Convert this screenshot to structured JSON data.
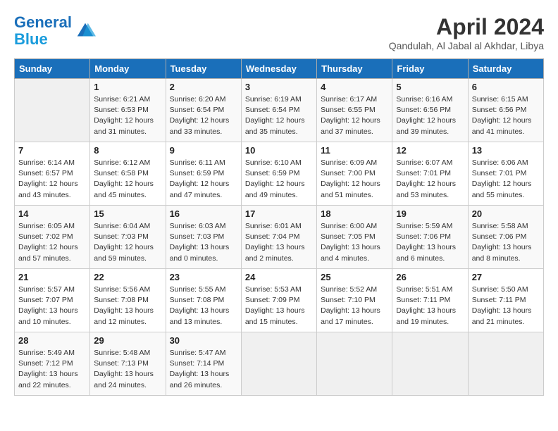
{
  "logo": {
    "line1": "General",
    "line2": "Blue"
  },
  "title": "April 2024",
  "location": "Qandulah, Al Jabal al Akhdar, Libya",
  "days_header": [
    "Sunday",
    "Monday",
    "Tuesday",
    "Wednesday",
    "Thursday",
    "Friday",
    "Saturday"
  ],
  "weeks": [
    [
      {
        "num": "",
        "info": ""
      },
      {
        "num": "1",
        "info": "Sunrise: 6:21 AM\nSunset: 6:53 PM\nDaylight: 12 hours\nand 31 minutes."
      },
      {
        "num": "2",
        "info": "Sunrise: 6:20 AM\nSunset: 6:54 PM\nDaylight: 12 hours\nand 33 minutes."
      },
      {
        "num": "3",
        "info": "Sunrise: 6:19 AM\nSunset: 6:54 PM\nDaylight: 12 hours\nand 35 minutes."
      },
      {
        "num": "4",
        "info": "Sunrise: 6:17 AM\nSunset: 6:55 PM\nDaylight: 12 hours\nand 37 minutes."
      },
      {
        "num": "5",
        "info": "Sunrise: 6:16 AM\nSunset: 6:56 PM\nDaylight: 12 hours\nand 39 minutes."
      },
      {
        "num": "6",
        "info": "Sunrise: 6:15 AM\nSunset: 6:56 PM\nDaylight: 12 hours\nand 41 minutes."
      }
    ],
    [
      {
        "num": "7",
        "info": "Sunrise: 6:14 AM\nSunset: 6:57 PM\nDaylight: 12 hours\nand 43 minutes."
      },
      {
        "num": "8",
        "info": "Sunrise: 6:12 AM\nSunset: 6:58 PM\nDaylight: 12 hours\nand 45 minutes."
      },
      {
        "num": "9",
        "info": "Sunrise: 6:11 AM\nSunset: 6:59 PM\nDaylight: 12 hours\nand 47 minutes."
      },
      {
        "num": "10",
        "info": "Sunrise: 6:10 AM\nSunset: 6:59 PM\nDaylight: 12 hours\nand 49 minutes."
      },
      {
        "num": "11",
        "info": "Sunrise: 6:09 AM\nSunset: 7:00 PM\nDaylight: 12 hours\nand 51 minutes."
      },
      {
        "num": "12",
        "info": "Sunrise: 6:07 AM\nSunset: 7:01 PM\nDaylight: 12 hours\nand 53 minutes."
      },
      {
        "num": "13",
        "info": "Sunrise: 6:06 AM\nSunset: 7:01 PM\nDaylight: 12 hours\nand 55 minutes."
      }
    ],
    [
      {
        "num": "14",
        "info": "Sunrise: 6:05 AM\nSunset: 7:02 PM\nDaylight: 12 hours\nand 57 minutes."
      },
      {
        "num": "15",
        "info": "Sunrise: 6:04 AM\nSunset: 7:03 PM\nDaylight: 12 hours\nand 59 minutes."
      },
      {
        "num": "16",
        "info": "Sunrise: 6:03 AM\nSunset: 7:03 PM\nDaylight: 13 hours\nand 0 minutes."
      },
      {
        "num": "17",
        "info": "Sunrise: 6:01 AM\nSunset: 7:04 PM\nDaylight: 13 hours\nand 2 minutes."
      },
      {
        "num": "18",
        "info": "Sunrise: 6:00 AM\nSunset: 7:05 PM\nDaylight: 13 hours\nand 4 minutes."
      },
      {
        "num": "19",
        "info": "Sunrise: 5:59 AM\nSunset: 7:06 PM\nDaylight: 13 hours\nand 6 minutes."
      },
      {
        "num": "20",
        "info": "Sunrise: 5:58 AM\nSunset: 7:06 PM\nDaylight: 13 hours\nand 8 minutes."
      }
    ],
    [
      {
        "num": "21",
        "info": "Sunrise: 5:57 AM\nSunset: 7:07 PM\nDaylight: 13 hours\nand 10 minutes."
      },
      {
        "num": "22",
        "info": "Sunrise: 5:56 AM\nSunset: 7:08 PM\nDaylight: 13 hours\nand 12 minutes."
      },
      {
        "num": "23",
        "info": "Sunrise: 5:55 AM\nSunset: 7:08 PM\nDaylight: 13 hours\nand 13 minutes."
      },
      {
        "num": "24",
        "info": "Sunrise: 5:53 AM\nSunset: 7:09 PM\nDaylight: 13 hours\nand 15 minutes."
      },
      {
        "num": "25",
        "info": "Sunrise: 5:52 AM\nSunset: 7:10 PM\nDaylight: 13 hours\nand 17 minutes."
      },
      {
        "num": "26",
        "info": "Sunrise: 5:51 AM\nSunset: 7:11 PM\nDaylight: 13 hours\nand 19 minutes."
      },
      {
        "num": "27",
        "info": "Sunrise: 5:50 AM\nSunset: 7:11 PM\nDaylight: 13 hours\nand 21 minutes."
      }
    ],
    [
      {
        "num": "28",
        "info": "Sunrise: 5:49 AM\nSunset: 7:12 PM\nDaylight: 13 hours\nand 22 minutes."
      },
      {
        "num": "29",
        "info": "Sunrise: 5:48 AM\nSunset: 7:13 PM\nDaylight: 13 hours\nand 24 minutes."
      },
      {
        "num": "30",
        "info": "Sunrise: 5:47 AM\nSunset: 7:14 PM\nDaylight: 13 hours\nand 26 minutes."
      },
      {
        "num": "",
        "info": ""
      },
      {
        "num": "",
        "info": ""
      },
      {
        "num": "",
        "info": ""
      },
      {
        "num": "",
        "info": ""
      }
    ]
  ]
}
